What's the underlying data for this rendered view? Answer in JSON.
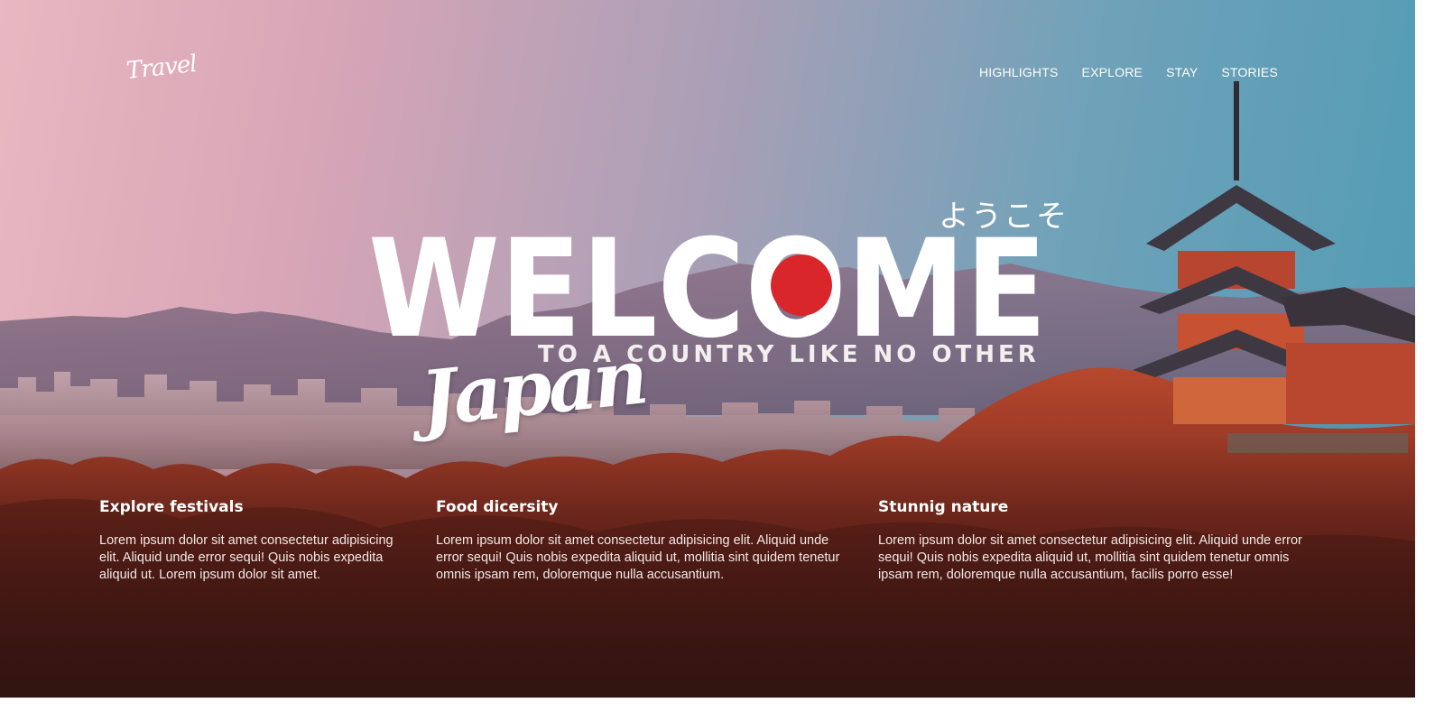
{
  "brand": {
    "logo_text": "Travel"
  },
  "nav": {
    "items": [
      {
        "label": "HIGHLIGHTS"
      },
      {
        "label": "EXPLORE"
      },
      {
        "label": "STAY"
      },
      {
        "label": "STORIES"
      }
    ]
  },
  "hero": {
    "japanese": "ようこそ",
    "welcome": "WELCOME",
    "tagline": "TO A COUNTRY LIKE NO OTHER",
    "script": "Japan",
    "accent_color": "#d8262a"
  },
  "features": [
    {
      "title": "Explore festivals",
      "text": "Lorem ipsum dolor sit amet consectetur adipisicing elit. Aliquid unde error sequi! Quis nobis expedita aliquid ut. Lorem ipsum dolor sit amet."
    },
    {
      "title": "Food dicersity",
      "text": "Lorem ipsum dolor sit amet consectetur adipisicing elit. Aliquid unde error sequi! Quis nobis expedita aliquid ut, mollitia sint quidem tenetur omnis ipsam rem, doloremque nulla accusantium."
    },
    {
      "title": "Stunnig nature",
      "text": "Lorem ipsum dolor sit amet consectetur adipisicing elit. Aliquid unde error sequi! Quis nobis expedita aliquid ut, mollitia sint quidem tenetur omnis ipsam rem, doloremque nulla accusantium, facilis porro esse!"
    }
  ]
}
